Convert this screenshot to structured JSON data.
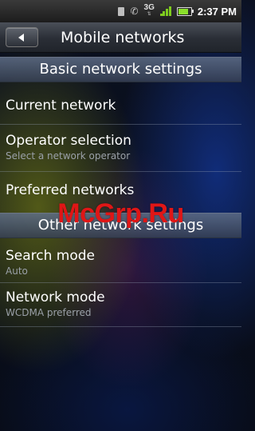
{
  "status_bar": {
    "network_type": "3G",
    "time": "2:37 PM",
    "battery_level": 0.8,
    "signal_bars": 4
  },
  "header": {
    "title": "Mobile networks"
  },
  "sections": [
    {
      "title": "Basic network settings",
      "items": [
        {
          "label": "Current network",
          "summary": ""
        },
        {
          "label": "Operator selection",
          "summary": "Select a network operator"
        },
        {
          "label": "Preferred networks",
          "summary": ""
        }
      ]
    },
    {
      "title": "Other network settings",
      "items": [
        {
          "label": "Search mode",
          "summary": "Auto"
        },
        {
          "label": "Network mode",
          "summary": "WCDMA preferred"
        }
      ]
    }
  ],
  "watermark": "McGrp.Ru",
  "colors": {
    "signal": "#7fcc1f",
    "watermark": "#e01616"
  }
}
